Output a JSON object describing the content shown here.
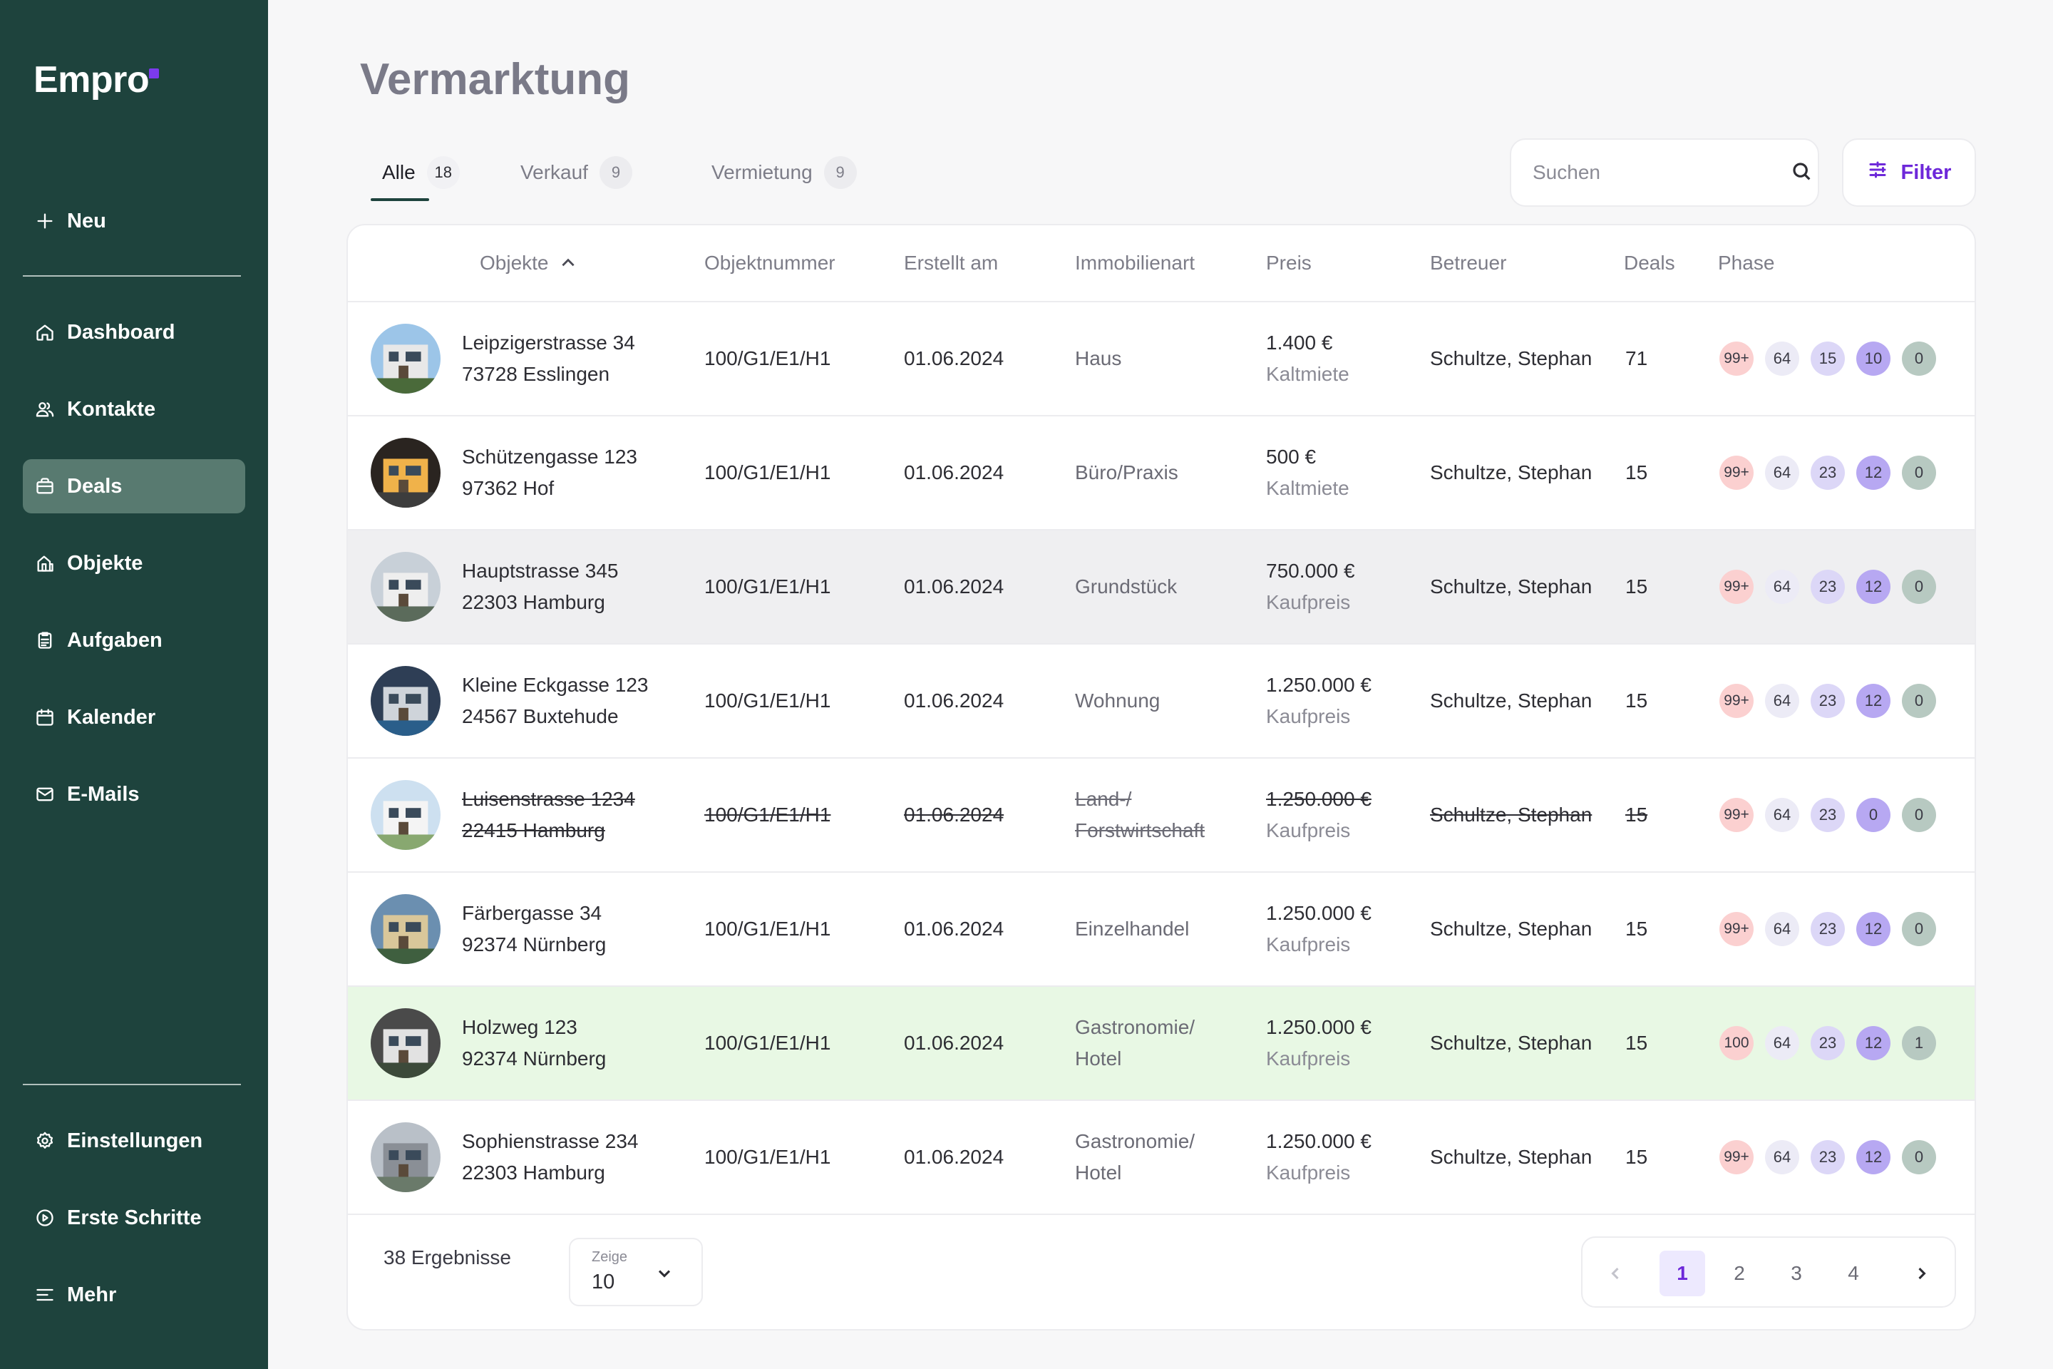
{
  "app": {
    "logo": "Empro"
  },
  "sidebar": {
    "new_label": "Neu",
    "items": [
      {
        "label": "Dashboard",
        "icon": "home-icon"
      },
      {
        "label": "Kontakte",
        "icon": "users-icon"
      },
      {
        "label": "Deals",
        "icon": "briefcase-icon",
        "active": true
      },
      {
        "label": "Objekte",
        "icon": "building-icon"
      },
      {
        "label": "Aufgaben",
        "icon": "clipboard-icon"
      },
      {
        "label": "Kalender",
        "icon": "calendar-icon"
      },
      {
        "label": "E-Mails",
        "icon": "mail-icon"
      }
    ],
    "bottom": [
      {
        "label": "Einstellungen",
        "icon": "gear-icon"
      },
      {
        "label": "Erste Schritte",
        "icon": "play-circle-icon"
      },
      {
        "label": "Mehr",
        "icon": "menu-icon"
      }
    ]
  },
  "page": {
    "title": "Vermarktung"
  },
  "tabs": [
    {
      "label": "Alle",
      "count": "18",
      "active": true
    },
    {
      "label": "Verkauf",
      "count": "9"
    },
    {
      "label": "Vermietung",
      "count": "9"
    }
  ],
  "search": {
    "placeholder": "Suchen",
    "value": ""
  },
  "filter": {
    "label": "Filter"
  },
  "table": {
    "columns": [
      "Objekte",
      "Objektnummer",
      "Erstellt am",
      "Immobilienart",
      "Preis",
      "Betreuer",
      "Deals",
      "Phase"
    ],
    "sort_column": "Objekte",
    "rows": [
      {
        "street": "Leipzigerstrasse 34",
        "city": "73728 Esslingen",
        "number": "100/G1/E1/H1",
        "created": "01.06.2024",
        "type1": "Haus",
        "type2": "",
        "price": "1.400 €",
        "price_type": "Kaltmiete",
        "agent": "Schultze, Stephan",
        "deals": "71",
        "phases": [
          "99+",
          "64",
          "15",
          "10",
          "0"
        ],
        "state": "normal"
      },
      {
        "street": "Schützengasse 123",
        "city": "97362 Hof",
        "number": "100/G1/E1/H1",
        "created": "01.06.2024",
        "type1": "Büro/Praxis",
        "type2": "",
        "price": "500 €",
        "price_type": "Kaltmiete",
        "agent": "Schultze, Stephan",
        "deals": "15",
        "phases": [
          "99+",
          "64",
          "23",
          "12",
          "0"
        ],
        "state": "normal"
      },
      {
        "street": "Hauptstrasse 345",
        "city": "22303 Hamburg",
        "number": "100/G1/E1/H1",
        "created": "01.06.2024",
        "type1": "Grundstück",
        "type2": "",
        "price": "750.000 €",
        "price_type": "Kaufpreis",
        "agent": "Schultze, Stephan",
        "deals": "15",
        "phases": [
          "99+",
          "64",
          "23",
          "12",
          "0"
        ],
        "state": "hover"
      },
      {
        "street": "Kleine Eckgasse 123",
        "city": "24567 Buxtehude",
        "number": "100/G1/E1/H1",
        "created": "01.06.2024",
        "type1": "Wohnung",
        "type2": "",
        "price": "1.250.000 €",
        "price_type": "Kaufpreis",
        "agent": "Schultze, Stephan",
        "deals": "15",
        "phases": [
          "99+",
          "64",
          "23",
          "12",
          "0"
        ],
        "state": "normal"
      },
      {
        "street": "Luisenstrasse 1234",
        "city": "22415 Hamburg",
        "number": "100/G1/E1/H1",
        "created": "01.06.2024",
        "type1": "Land-/",
        "type2": "Forstwirtschaft",
        "price": "1.250.000 €",
        "price_type": "Kaufpreis",
        "agent": "Schultze, Stephan",
        "deals": "15",
        "phases": [
          "99+",
          "64",
          "23",
          "0",
          "0"
        ],
        "state": "archived"
      },
      {
        "street": "Färbergasse 34",
        "city": "92374 Nürnberg",
        "number": "100/G1/E1/H1",
        "created": "01.06.2024",
        "type1": "Einzelhandel",
        "type2": "",
        "price": "1.250.000 €",
        "price_type": "Kaufpreis",
        "agent": "Schultze, Stephan",
        "deals": "15",
        "phases": [
          "99+",
          "64",
          "23",
          "12",
          "0"
        ],
        "state": "normal"
      },
      {
        "street": "Holzweg 123",
        "city": "92374 Nürnberg",
        "number": "100/G1/E1/H1",
        "created": "01.06.2024",
        "type1": "Gastronomie/",
        "type2": "Hotel",
        "price": "1.250.000 €",
        "price_type": "Kaufpreis",
        "agent": "Schultze, Stephan",
        "deals": "15",
        "phases": [
          "100",
          "64",
          "23",
          "12",
          "1"
        ],
        "state": "success"
      },
      {
        "street": "Sophienstrasse 234",
        "city": "22303 Hamburg",
        "number": "100/G1/E1/H1",
        "created": "01.06.2024",
        "type1": "Gastronomie/",
        "type2": "Hotel",
        "price": "1.250.000 €",
        "price_type": "Kaufpreis",
        "agent": "Schultze, Stephan",
        "deals": "15",
        "phases": [
          "99+",
          "64",
          "23",
          "12",
          "0"
        ],
        "state": "normal"
      }
    ]
  },
  "footer": {
    "results": "38 Ergebnisse",
    "per_page_label": "Zeige",
    "per_page_value": "10",
    "pages": [
      "1",
      "2",
      "3",
      "4"
    ],
    "current_page": "1"
  },
  "colors": {
    "sidebar_bg": "#1e433d",
    "active_nav": "#587a70",
    "accent": "#6d28d9",
    "hover_row": "#efeff1",
    "success_row": "#e8f8e4"
  }
}
